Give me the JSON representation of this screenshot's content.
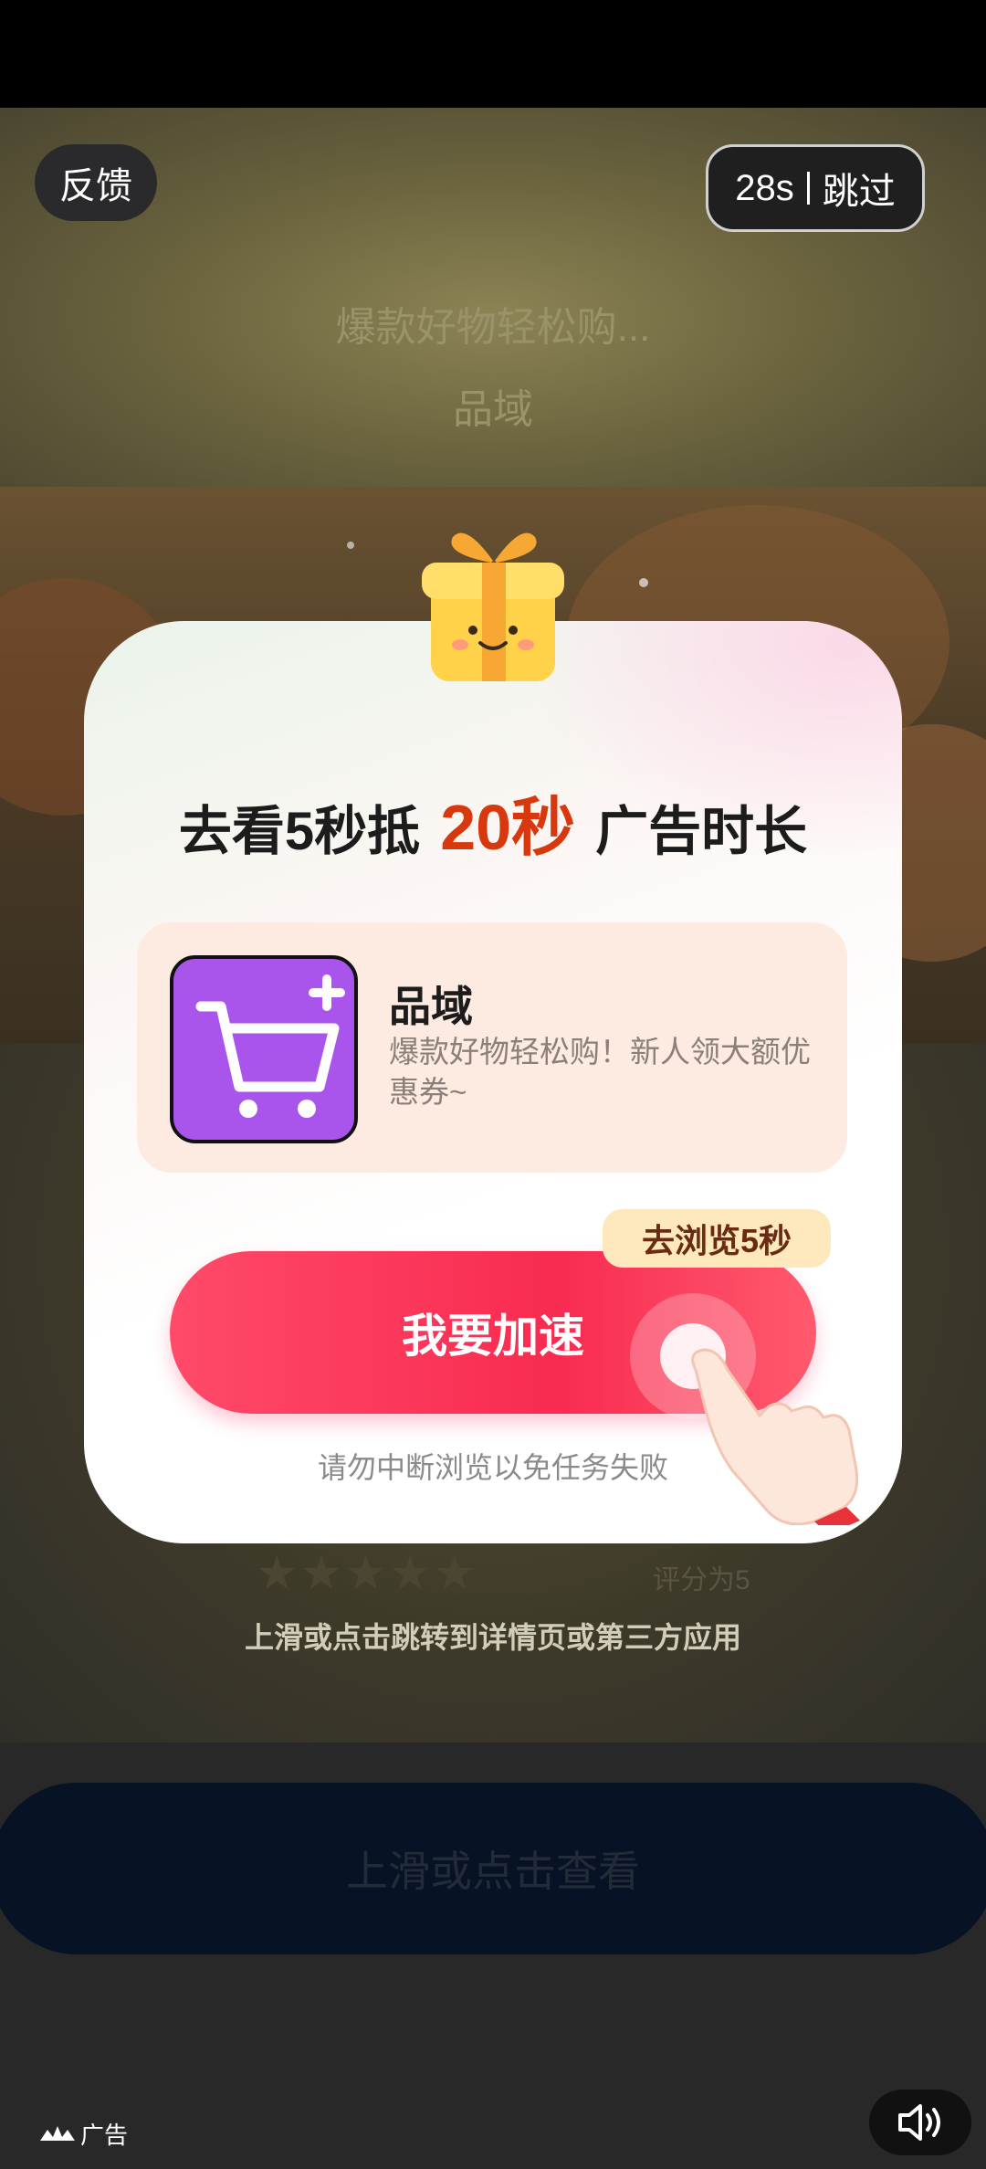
{
  "top_bar": {
    "feedback_label": "反馈",
    "countdown": "28s",
    "skip_label": "跳过"
  },
  "ad": {
    "headline": "爆款好物轻松购...",
    "brand": "品域",
    "rating_text": "评分为5",
    "stars": 5,
    "swipe_hint": "上滑或点击跳转到详情页或第三方应用",
    "cta_label": "上滑或点击查看",
    "ad_label": "广告"
  },
  "dialog": {
    "title_prefix": "去看5秒抵",
    "title_highlight": "20秒",
    "title_suffix": "广告时长",
    "app": {
      "name": "品域",
      "description": "爆款好物轻松购！新人领大额优惠券~"
    },
    "badge": "去浏览5秒",
    "button_label": "我要加速",
    "warning": "请勿中断浏览以免任务失败"
  },
  "colors": {
    "accent": "#f82b50",
    "highlight": "#d8380e",
    "app_icon": "#a955ec"
  },
  "icons": [
    "gift-icon",
    "cart-plus-icon",
    "hand-pointer-icon",
    "volume-icon",
    "ad-logo-icon",
    "star-icon"
  ]
}
